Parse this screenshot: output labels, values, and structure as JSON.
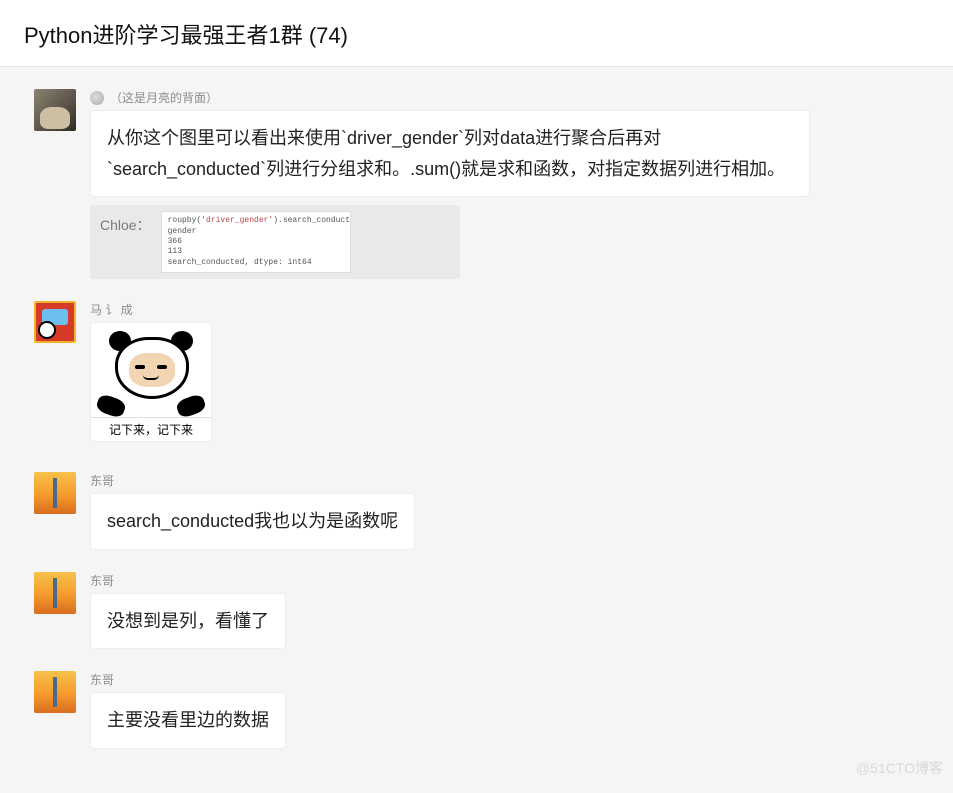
{
  "header": {
    "title": "Python进阶学习最强王者1群 (74)"
  },
  "messages": [
    {
      "sender": "（这是月亮的背面）",
      "has_grade_icon": true,
      "text": "从你这个图里可以看出来使用`driver_gender`列对data进行聚合后再对`search_conducted`列进行分组求和。.sum()就是求和函数，对指定数据列进行相加。",
      "quote": {
        "sender_label": "Chloe：",
        "code_l1_a": "roupby(",
        "code_l1_b": "'driver_gender'",
        "code_l1_c": ").search_conducte",
        "code_rest": "gender\n366\n113\nsearch_conducted, dtype: int64"
      }
    },
    {
      "sender": "马 讠 成",
      "sticker_caption": "记下来，记下来"
    },
    {
      "sender": "东哥",
      "text": "search_conducted我也以为是函数呢"
    },
    {
      "sender": "东哥",
      "text": "没想到是列，看懂了"
    },
    {
      "sender": "东哥",
      "text": "主要没看里边的数据"
    }
  ],
  "watermark": "@51CTO博客"
}
